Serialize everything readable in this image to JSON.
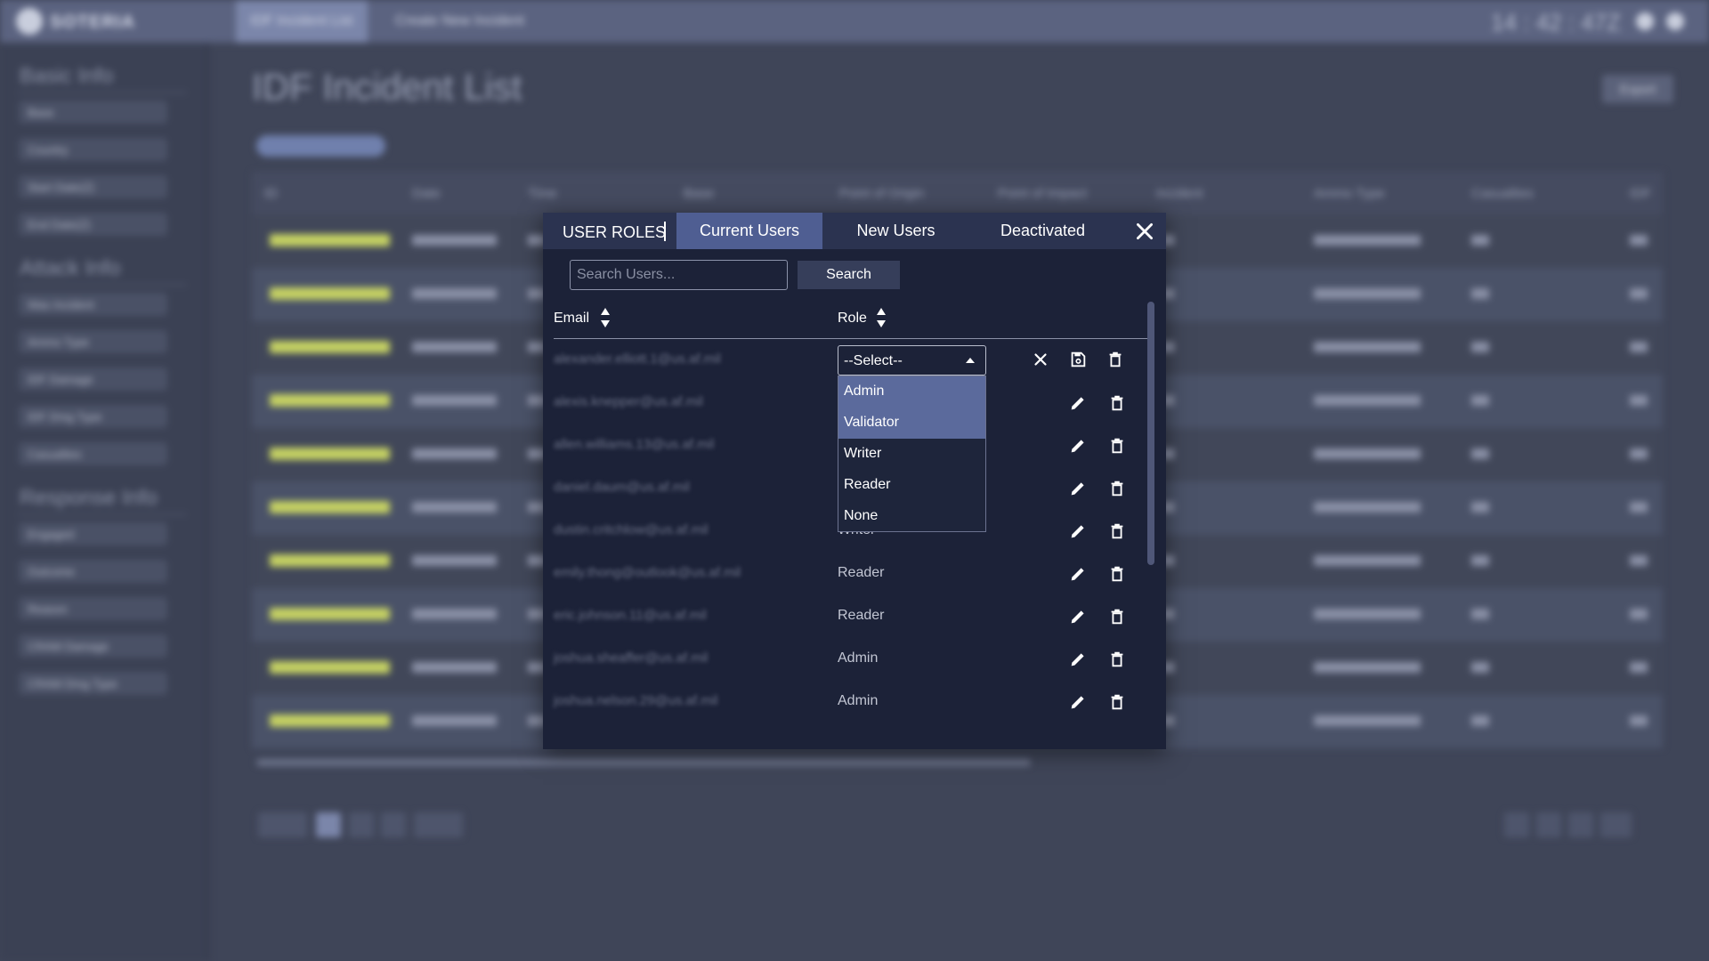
{
  "app": {
    "logo": "SOTERIA",
    "nav": [
      "IDF Incident List",
      "Create New Incident"
    ],
    "clock": "14 : 42 : 47Z",
    "page_title": "IDF Incident List",
    "export_label": "Export",
    "sidebar": {
      "sections": [
        {
          "title": "Basic Info",
          "fields": [
            "Base",
            "Country",
            "Start Date(Z)",
            "End Date(Z)"
          ]
        },
        {
          "title": "Attack Info",
          "fields": [
            "Was Incident",
            "Ammo Type",
            "IDF Damage",
            "IDF Dmg Type",
            "Casualties"
          ]
        },
        {
          "title": "Response Info",
          "fields": [
            "Engaged",
            "Outcome",
            "Reason",
            "CRAM Damage",
            "CRAM Dmg Type"
          ]
        }
      ]
    },
    "grid_headers": [
      "ID",
      "Date",
      "Time",
      "Base",
      "Point of Origin",
      "Point of Impact",
      "Incident",
      "Ammo Type",
      "Casualties",
      "IDF"
    ]
  },
  "modal": {
    "title": "USER ROLES",
    "tabs": [
      {
        "label": "Current Users",
        "active": true
      },
      {
        "label": "New Users",
        "active": false
      },
      {
        "label": "Deactivated",
        "active": false
      }
    ],
    "search": {
      "placeholder": "Search Users...",
      "button": "Search"
    },
    "columns": {
      "email": "Email",
      "role": "Role"
    },
    "editing_row": {
      "email": "alexander.elliott.1@us.af.mil",
      "select_value": "--Select--",
      "options": [
        {
          "label": "Admin",
          "highlighted": true
        },
        {
          "label": "Validator",
          "highlighted": true
        },
        {
          "label": "Writer",
          "highlighted": false
        },
        {
          "label": "Reader",
          "highlighted": false
        },
        {
          "label": "None",
          "highlighted": false
        }
      ]
    },
    "users": [
      {
        "email": "alexis.knepper@us.af.mil",
        "role": ""
      },
      {
        "email": "allen.williams.13@us.af.mil",
        "role": ""
      },
      {
        "email": "daniel.daum@us.af.mil",
        "role": ""
      },
      {
        "email": "dustin.critchlow@us.af.mil",
        "role": "Writer"
      },
      {
        "email": "emily.thong@outlook@us.af.mil",
        "role": "Reader"
      },
      {
        "email": "eric.johnson.11@us.af.mil",
        "role": "Reader"
      },
      {
        "email": "joshua.sheaffer@us.af.mil",
        "role": "Admin"
      },
      {
        "email": "joshua.nelson.29@us.af.mil",
        "role": "Admin"
      }
    ]
  }
}
